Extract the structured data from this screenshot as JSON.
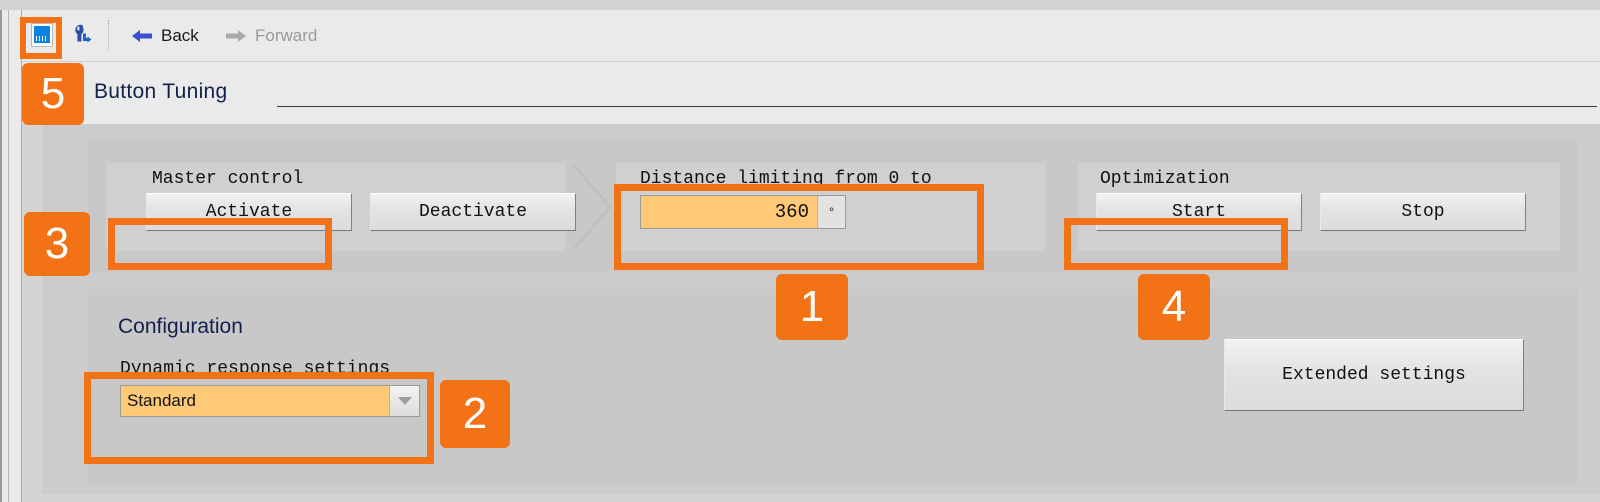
{
  "window": {
    "page_title": "Button Tuning"
  },
  "toolbar": {
    "icons": [
      {
        "name": "device-card-icon",
        "label": "device-card"
      },
      {
        "name": "wrench-tools-icon",
        "label": "tools"
      }
    ],
    "back_label": "Back",
    "forward_label": "Forward",
    "back_enabled": true,
    "forward_enabled": false
  },
  "main": {
    "master_control": {
      "label": "Master control",
      "activate_label": "Activate",
      "deactivate_label": "Deactivate"
    },
    "distance_limiting": {
      "label": "Distance limiting from 0 to",
      "value": "360",
      "unit": "°"
    },
    "optimization": {
      "label": "Optimization",
      "start_label": "Start",
      "stop_label": "Stop"
    },
    "configuration": {
      "title": "Configuration",
      "dynamic_response_label": "Dynamic response settings",
      "dynamic_response_value": "Standard",
      "extended_settings_label": "Extended settings"
    }
  },
  "annotations": {
    "badges": [
      {
        "id": "1",
        "target": "distance-limiting-field"
      },
      {
        "id": "2",
        "target": "dynamic-response-settings"
      },
      {
        "id": "3",
        "target": "activate-button"
      },
      {
        "id": "4",
        "target": "start-button"
      },
      {
        "id": "5",
        "target": "device-card-toolbar-icon"
      }
    ],
    "highlight_color": "#f47216"
  },
  "colors": {
    "accent": "#f47216",
    "field_fill": "#ffc977",
    "title_text": "#12214b",
    "panel": "#cccccc",
    "toolbar_bg": "#eaeaea"
  }
}
